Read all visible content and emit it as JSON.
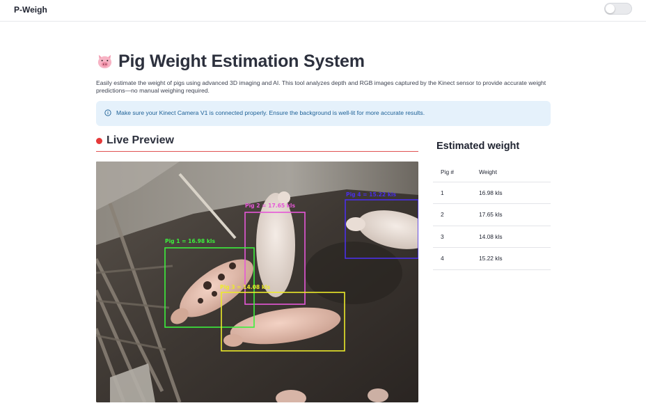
{
  "header": {
    "brand": "P-Weigh",
    "theme_toggle": false
  },
  "page": {
    "title": "Pig Weight Estimation System",
    "title_icon": "pig-face-emoji",
    "description": "Easily estimate the weight of pigs using advanced 3D imaging and AI. This tool analyzes depth and RGB images captured by the Kinect sensor to provide accurate weight predictions—no manual weighing required."
  },
  "info_banner": {
    "icon": "info-circle-icon",
    "text": "Make sure your Kinect Camera V1 is connected properly. Ensure the background is well-lit for more accurate results."
  },
  "live_preview": {
    "title": "Live Preview",
    "indicator_color": "#e53939",
    "detections": [
      {
        "label": "Pig 1 = 16.98 kls",
        "color": "#3cf03c"
      },
      {
        "label": "Pig 2 = 17.65 kls",
        "color": "#e657d8"
      },
      {
        "label": "Pig 3 = 14.08 kls",
        "color": "#ecea2a"
      },
      {
        "label": "Pig 4 = 15.22 kls",
        "color": "#4a2fe8"
      }
    ]
  },
  "estimated_weight": {
    "title": "Estimated weight",
    "columns": [
      "Pig #",
      "Weight"
    ],
    "rows": [
      {
        "pig": "1",
        "weight": "16.98 kls"
      },
      {
        "pig": "2",
        "weight": "17.65 kls"
      },
      {
        "pig": "3",
        "weight": "14.08 kls"
      },
      {
        "pig": "4",
        "weight": "15.22 kls"
      }
    ]
  }
}
